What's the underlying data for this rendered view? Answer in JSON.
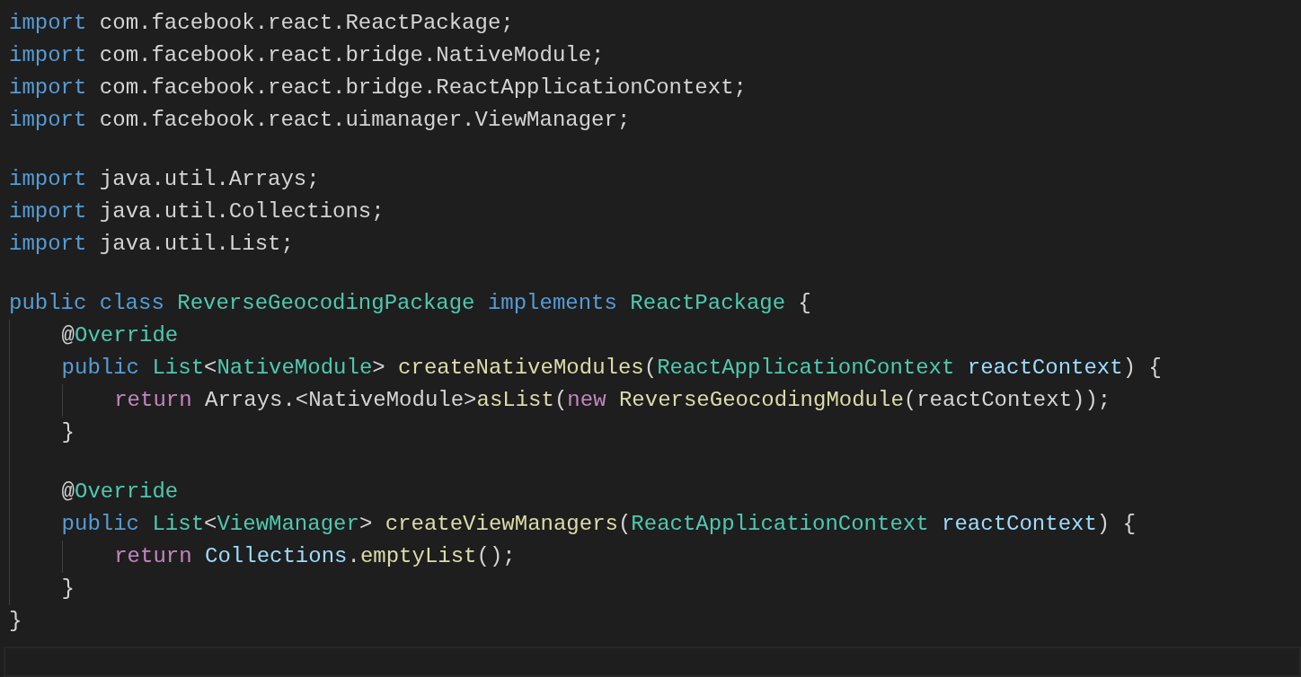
{
  "editor": {
    "lines": [
      {
        "kind": "code",
        "tokens": [
          {
            "text": "import",
            "kind": "keyword"
          },
          {
            "text": " com.facebook.react.ReactPackage;",
            "kind": "plain"
          }
        ]
      },
      {
        "kind": "code",
        "tokens": [
          {
            "text": "import",
            "kind": "keyword"
          },
          {
            "text": " com.facebook.react.bridge.NativeModule;",
            "kind": "plain"
          }
        ]
      },
      {
        "kind": "code",
        "tokens": [
          {
            "text": "import",
            "kind": "keyword"
          },
          {
            "text": " com.facebook.react.bridge.ReactApplicationContext;",
            "kind": "plain"
          }
        ]
      },
      {
        "kind": "code",
        "tokens": [
          {
            "text": "import",
            "kind": "keyword"
          },
          {
            "text": " com.facebook.react.uimanager.ViewManager;",
            "kind": "plain"
          }
        ]
      },
      {
        "kind": "blank"
      },
      {
        "kind": "code",
        "tokens": [
          {
            "text": "import",
            "kind": "keyword"
          },
          {
            "text": " java.util.Arrays;",
            "kind": "plain"
          }
        ]
      },
      {
        "kind": "code",
        "tokens": [
          {
            "text": "import",
            "kind": "keyword"
          },
          {
            "text": " java.util.Collections;",
            "kind": "plain"
          }
        ]
      },
      {
        "kind": "code",
        "tokens": [
          {
            "text": "import",
            "kind": "keyword"
          },
          {
            "text": " java.util.List;",
            "kind": "plain"
          }
        ]
      },
      {
        "kind": "blank"
      },
      {
        "kind": "code",
        "tokens": [
          {
            "text": "public class ",
            "kind": "keyword"
          },
          {
            "text": "ReverseGeocodingPackage ",
            "kind": "type"
          },
          {
            "text": "implements ",
            "kind": "keyword"
          },
          {
            "text": "ReactPackage",
            "kind": "type"
          },
          {
            "text": " {",
            "kind": "plain"
          }
        ]
      },
      {
        "kind": "code",
        "tokens": [
          {
            "text": "    @",
            "kind": "plain"
          },
          {
            "text": "Override",
            "kind": "type"
          }
        ]
      },
      {
        "kind": "code",
        "tokens": [
          {
            "text": "    public ",
            "kind": "keyword"
          },
          {
            "text": "List",
            "kind": "type"
          },
          {
            "text": "<",
            "kind": "plain"
          },
          {
            "text": "NativeModule",
            "kind": "type"
          },
          {
            "text": "> ",
            "kind": "plain"
          },
          {
            "text": "createNativeModules",
            "kind": "function"
          },
          {
            "text": "(",
            "kind": "plain"
          },
          {
            "text": "ReactApplicationContext ",
            "kind": "type"
          },
          {
            "text": "reactContext",
            "kind": "variable"
          },
          {
            "text": ") {",
            "kind": "plain"
          }
        ]
      },
      {
        "kind": "code",
        "tokens": [
          {
            "text": "        return",
            "kind": "control"
          },
          {
            "text": " Arrays.<NativeModule>",
            "kind": "plain"
          },
          {
            "text": "asList",
            "kind": "function"
          },
          {
            "text": "(",
            "kind": "plain"
          },
          {
            "text": "new ",
            "kind": "control"
          },
          {
            "text": "ReverseGeocodingModule",
            "kind": "function"
          },
          {
            "text": "(reactContext));",
            "kind": "plain"
          }
        ]
      },
      {
        "kind": "code",
        "tokens": [
          {
            "text": "    }",
            "kind": "plain"
          }
        ]
      },
      {
        "kind": "blank"
      },
      {
        "kind": "code",
        "tokens": [
          {
            "text": "    @",
            "kind": "plain"
          },
          {
            "text": "Override",
            "kind": "type"
          }
        ]
      },
      {
        "kind": "code",
        "tokens": [
          {
            "text": "    public ",
            "kind": "keyword"
          },
          {
            "text": "List",
            "kind": "type"
          },
          {
            "text": "<",
            "kind": "plain"
          },
          {
            "text": "ViewManager",
            "kind": "type"
          },
          {
            "text": "> ",
            "kind": "plain"
          },
          {
            "text": "createViewManagers",
            "kind": "function"
          },
          {
            "text": "(",
            "kind": "plain"
          },
          {
            "text": "ReactApplicationContext ",
            "kind": "type"
          },
          {
            "text": "reactContext",
            "kind": "variable"
          },
          {
            "text": ") {",
            "kind": "plain"
          }
        ]
      },
      {
        "kind": "code",
        "tokens": [
          {
            "text": "        return ",
            "kind": "control"
          },
          {
            "text": "Collections",
            "kind": "variable"
          },
          {
            "text": ".",
            "kind": "plain"
          },
          {
            "text": "emptyList",
            "kind": "function"
          },
          {
            "text": "();",
            "kind": "plain"
          }
        ]
      },
      {
        "kind": "code",
        "tokens": [
          {
            "text": "    }",
            "kind": "plain"
          }
        ]
      },
      {
        "kind": "code",
        "tokens": [
          {
            "text": "}",
            "kind": "plain"
          }
        ]
      }
    ]
  }
}
